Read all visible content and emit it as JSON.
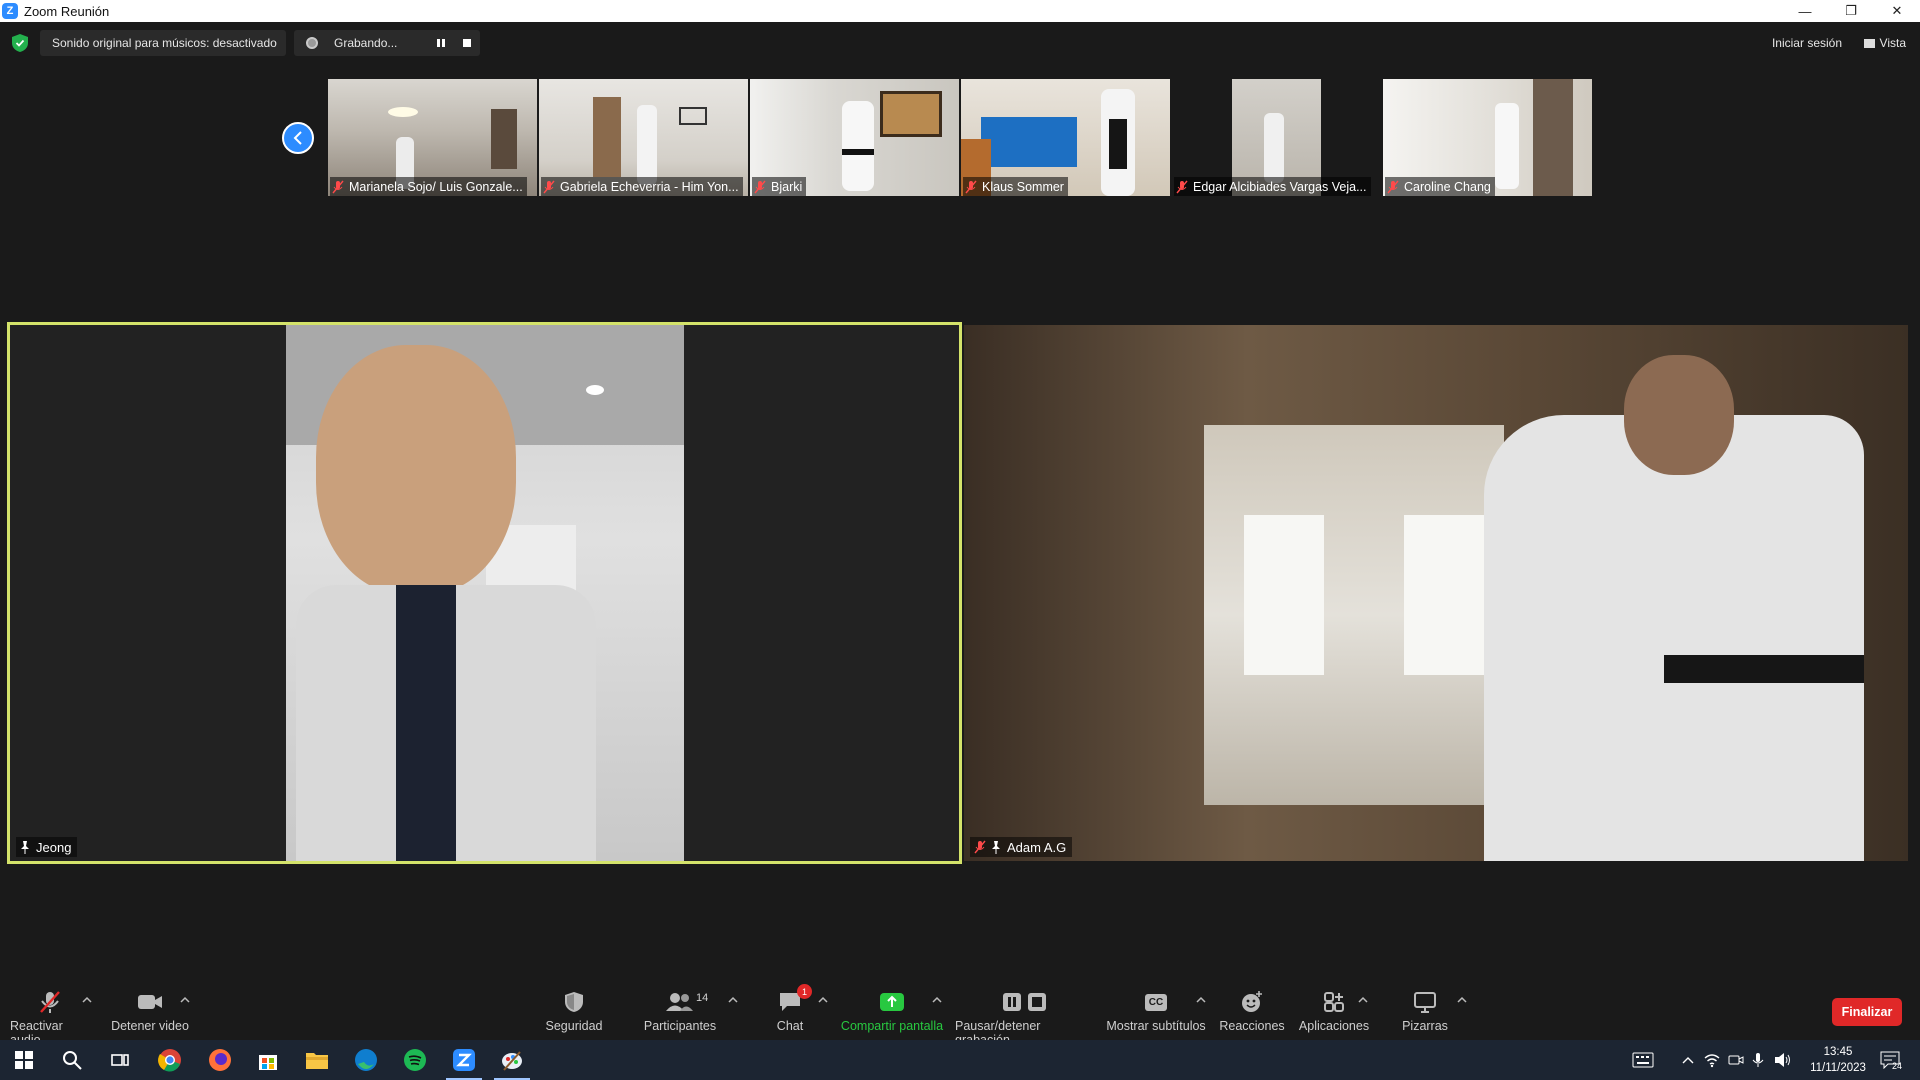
{
  "window": {
    "title": "Zoom Reunión"
  },
  "topbar": {
    "original_sound": "Sonido original para músicos: desactivado",
    "recording": "Grabando...",
    "sign_in": "Iniciar sesión",
    "view": "Vista"
  },
  "thumbnails": [
    {
      "name": "Marianela Sojo/ Luis Gonzale...",
      "muted": true
    },
    {
      "name": "Gabriela Echeverria - Him Yon...",
      "muted": true
    },
    {
      "name": "Bjarki",
      "muted": true
    },
    {
      "name": "Klaus Sommer",
      "muted": true
    },
    {
      "name": "Edgar Alcibiades Vargas Veja...",
      "muted": true
    },
    {
      "name": "Caroline Chang",
      "muted": true
    }
  ],
  "main_tiles": [
    {
      "name": "Jeong",
      "pinned": true,
      "muted": false,
      "active_speaker": true
    },
    {
      "name": "Adam A.G",
      "pinned": true,
      "muted": true,
      "active_speaker": false
    }
  ],
  "toolbar": {
    "unmute": "Reactivar audio",
    "stop_video": "Detener video",
    "security": "Seguridad",
    "participants": "Participantes",
    "participants_count": "14",
    "chat": "Chat",
    "chat_badge": "1",
    "share_screen": "Compartir pantalla",
    "pause_stop_recording": "Pausar/detener grabación",
    "captions": "Mostrar subtítulos",
    "captions_icon": "CC",
    "reactions": "Reacciones",
    "apps": "Aplicaciones",
    "whiteboards": "Pizarras",
    "end": "Finalizar"
  },
  "taskbar": {
    "time": "13:45",
    "date": "11/11/2023",
    "notifications": "24"
  },
  "colors": {
    "zoom_blue": "#2d8cff",
    "share_green": "#28c840",
    "end_red": "#e02828",
    "speaker_outline": "#d4e36a"
  }
}
